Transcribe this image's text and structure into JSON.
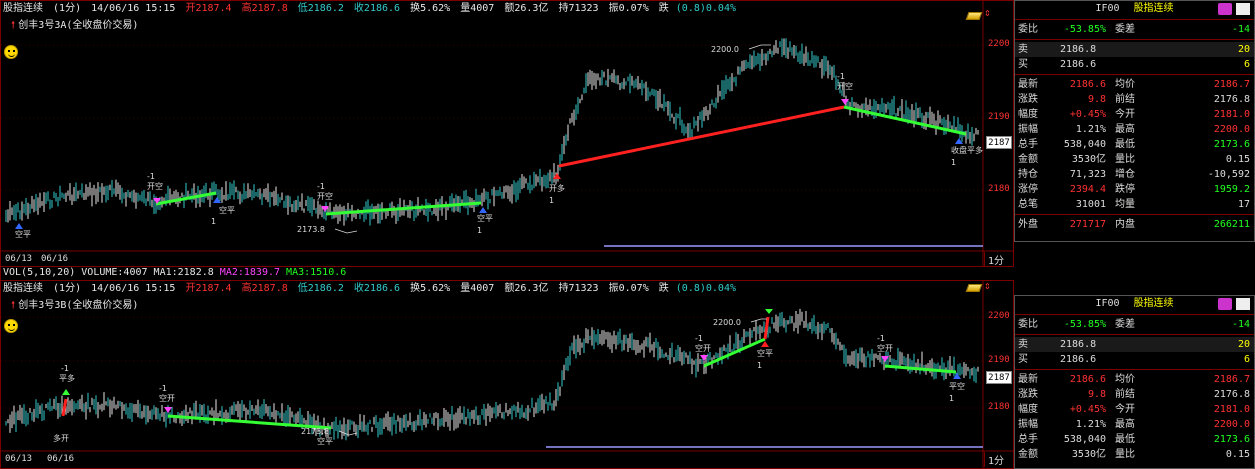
{
  "pane1": {
    "info": {
      "name": "股指连续",
      "period": "(1分)",
      "datetime": "14/06/16 15:15",
      "open": "开2187.4",
      "high": "高2187.8",
      "low": "低2186.2",
      "close": "收2186.6",
      "turnover": "换5.62%",
      "volume": "量4007",
      "amount": "额26.3亿",
      "position": "持71323",
      "amplitude": "振0.07%",
      "change_label": "跌",
      "change_value": "(0.8)0.04%"
    },
    "strategy": "创丰3号3A(全收盘价交易)",
    "y_ticks": [
      "2200",
      "2190",
      "2180"
    ],
    "current_price": "2187",
    "annotations": {
      "high_label": "2200.0",
      "low_label": "2173.8"
    },
    "dates": [
      "06/13",
      "06/16"
    ],
    "period_tag": "1分",
    "signals": [
      {
        "label": "空平",
        "qty": ""
      },
      {
        "label": "-1",
        "qty": ""
      },
      {
        "label": "开空",
        "qty": ""
      },
      {
        "label": "空平",
        "qty": "1"
      },
      {
        "label": "-1",
        "qty": ""
      },
      {
        "label": "开空",
        "qty": ""
      },
      {
        "label": "空平",
        "qty": "1"
      },
      {
        "label": "开多",
        "qty": "1"
      },
      {
        "label": "-1",
        "qty": ""
      },
      {
        "label": "开空",
        "qty": ""
      },
      {
        "label": "收盘平多",
        "qty": "1"
      }
    ]
  },
  "vol_strip": {
    "name": "VOL(5,10,20)",
    "volume": "VOLUME:4007",
    "ma1": "MA1:2182.8",
    "ma2": "MA2:1839.7",
    "ma3": "MA3:1510.6"
  },
  "pane2": {
    "info": {
      "name": "股指连续",
      "period": "(1分)",
      "datetime": "14/06/16 15:15",
      "open": "开2187.4",
      "high": "高2187.8",
      "low": "低2186.2",
      "close": "收2186.6",
      "turnover": "换5.62%",
      "volume": "量4007",
      "amount": "额26.3亿",
      "position": "持71323",
      "amplitude": "振0.07%",
      "change_label": "跌",
      "change_value": "(0.8)0.04%"
    },
    "strategy": "创丰3号3B(全收盘价交易)",
    "y_ticks": [
      "2200",
      "2190",
      "2180"
    ],
    "current_price": "2187",
    "annotations": {
      "high_label": "2200.0",
      "low_label": "2173.8"
    },
    "dates": [
      "06/13",
      "06/16"
    ],
    "period_tag": "1分",
    "signals": [
      {
        "label": "-1",
        "qty": ""
      },
      {
        "label": "平多",
        "qty": ""
      },
      {
        "label": "多开",
        "qty": ""
      },
      {
        "label": "-1",
        "qty": ""
      },
      {
        "label": "空开",
        "qty": ""
      },
      {
        "label": "空平",
        "qty": ""
      },
      {
        "label": "-1",
        "qty": ""
      },
      {
        "label": "空开",
        "qty": ""
      },
      {
        "label": "空平",
        "qty": "1"
      },
      {
        "label": "-1",
        "qty": ""
      },
      {
        "label": "空开",
        "qty": ""
      },
      {
        "label": "平空",
        "qty": "1"
      }
    ]
  },
  "quote1": {
    "code": "IF00",
    "name": "股指连续",
    "weibi_label": "委比",
    "weibi_value": "-53.85%",
    "weicha_label": "委差",
    "weicha_value": "-14",
    "sell_label": "卖",
    "sell_price": "2186.8",
    "sell_vol": "20",
    "buy_label": "买",
    "buy_price": "2186.6",
    "buy_vol": "6",
    "rows": [
      {
        "l1": "最新",
        "v1": "2186.6",
        "c1": "#ff3232",
        "l2": "均价",
        "v2": "2186.7",
        "c2": "#ff3232"
      },
      {
        "l1": "涨跌",
        "v1": "9.8",
        "c1": "#ff3232",
        "l2": "前结",
        "v2": "2176.8",
        "c2": "#dddddd"
      },
      {
        "l1": "幅度",
        "v1": "+0.45%",
        "c1": "#ff3232",
        "l2": "今开",
        "v2": "2181.0",
        "c2": "#ff3232"
      },
      {
        "l1": "振幅",
        "v1": "1.21%",
        "c1": "#dddddd",
        "l2": "最高",
        "v2": "2200.0",
        "c2": "#ff3232"
      },
      {
        "l1": "总手",
        "v1": "538,040",
        "c1": "#dddddd",
        "l2": "最低",
        "v2": "2173.6",
        "c2": "#20ff20"
      },
      {
        "l1": "金额",
        "v1": "3530亿",
        "c1": "#dddddd",
        "l2": "量比",
        "v2": "0.15",
        "c2": "#dddddd"
      },
      {
        "l1": "持仓",
        "v1": "71,323",
        "c1": "#dddddd",
        "l2": "增仓",
        "v2": "-10,592",
        "c2": "#dddddd"
      },
      {
        "l1": "涨停",
        "v1": "2394.4",
        "c1": "#ff3232",
        "l2": "跌停",
        "v2": "1959.2",
        "c2": "#20ff20"
      },
      {
        "l1": "总笔",
        "v1": "31001",
        "c1": "#dddddd",
        "l2": "均量",
        "v2": "17",
        "c2": "#dddddd"
      }
    ],
    "outer_label": "外盘",
    "outer_value": "271717",
    "inner_label": "内盘",
    "inner_value": "266211"
  },
  "quote2": {
    "code": "IF00",
    "name": "股指连续",
    "weibi_label": "委比",
    "weibi_value": "-53.85%",
    "weicha_label": "委差",
    "weicha_value": "-14",
    "sell_label": "卖",
    "sell_price": "2186.8",
    "sell_vol": "20",
    "buy_label": "买",
    "buy_price": "2186.6",
    "buy_vol": "6",
    "rows": [
      {
        "l1": "最新",
        "v1": "2186.6",
        "c1": "#ff3232",
        "l2": "均价",
        "v2": "2186.7",
        "c2": "#ff3232"
      },
      {
        "l1": "涨跌",
        "v1": "9.8",
        "c1": "#ff3232",
        "l2": "前结",
        "v2": "2176.8",
        "c2": "#dddddd"
      },
      {
        "l1": "幅度",
        "v1": "+0.45%",
        "c1": "#ff3232",
        "l2": "今开",
        "v2": "2181.0",
        "c2": "#ff3232"
      },
      {
        "l1": "振幅",
        "v1": "1.21%",
        "c1": "#dddddd",
        "l2": "最高",
        "v2": "2200.0",
        "c2": "#ff3232"
      },
      {
        "l1": "总手",
        "v1": "538,040",
        "c1": "#dddddd",
        "l2": "最低",
        "v2": "2173.6",
        "c2": "#20ff20"
      },
      {
        "l1": "金额",
        "v1": "3530亿",
        "c1": "#dddddd",
        "l2": "量比",
        "v2": "0.15",
        "c2": "#dddddd"
      }
    ]
  }
}
